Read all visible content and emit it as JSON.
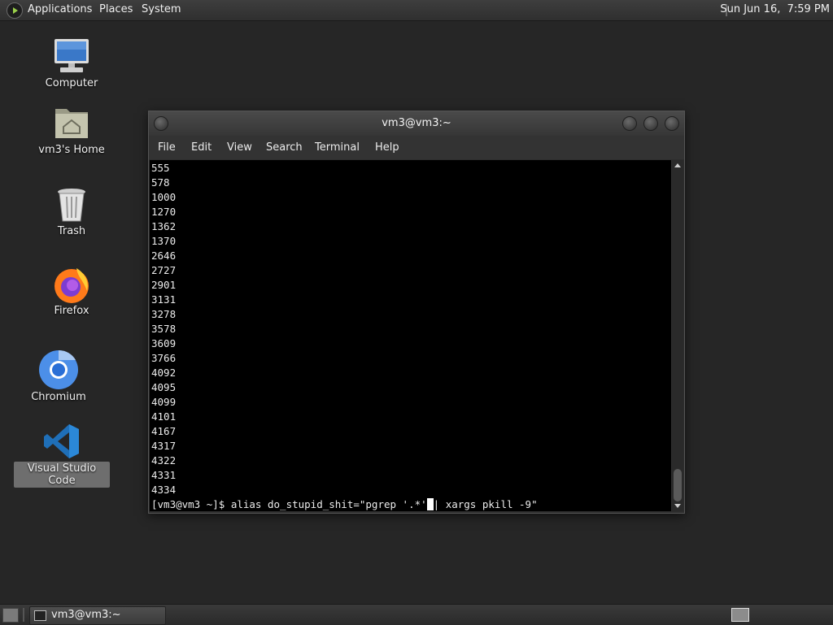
{
  "top_panel": {
    "menus": [
      "Applications",
      "Places",
      "System"
    ],
    "clock": "Sun Jun 16,  7:59 PM"
  },
  "desktop": {
    "icons": [
      {
        "label": "Computer",
        "icon": "computer-icon"
      },
      {
        "label": "vm3's Home",
        "icon": "home-folder-icon"
      },
      {
        "label": "Trash",
        "icon": "trash-icon"
      },
      {
        "label": "Firefox",
        "icon": "firefox-icon"
      },
      {
        "label": "Chromium",
        "icon": "chromium-icon"
      },
      {
        "label": "Visual Studio Code",
        "icon": "vscode-icon",
        "selected": true
      }
    ]
  },
  "terminal": {
    "title": "vm3@vm3:~",
    "menu": [
      "File",
      "Edit",
      "View",
      "Search",
      "Terminal",
      "Help"
    ],
    "output_lines": [
      "555",
      "578",
      "1000",
      "1270",
      "1362",
      "1370",
      "2646",
      "2727",
      "2901",
      "3131",
      "3278",
      "3578",
      "3609",
      "3766",
      "4092",
      "4095",
      "4099",
      "4101",
      "4167",
      "4317",
      "4322",
      "4331",
      "4334"
    ],
    "prompt_before_cursor": "[vm3@vm3 ~]$ alias do_stupid_shit=\"pgrep '.*'",
    "prompt_after_cursor": "| xargs pkill -9\""
  },
  "taskbar": {
    "task_label": "vm3@vm3:~"
  },
  "colors": {
    "desktop_bg": "#262626",
    "terminal_bg": "#000000",
    "selection_bg": "#6e6e6e"
  }
}
